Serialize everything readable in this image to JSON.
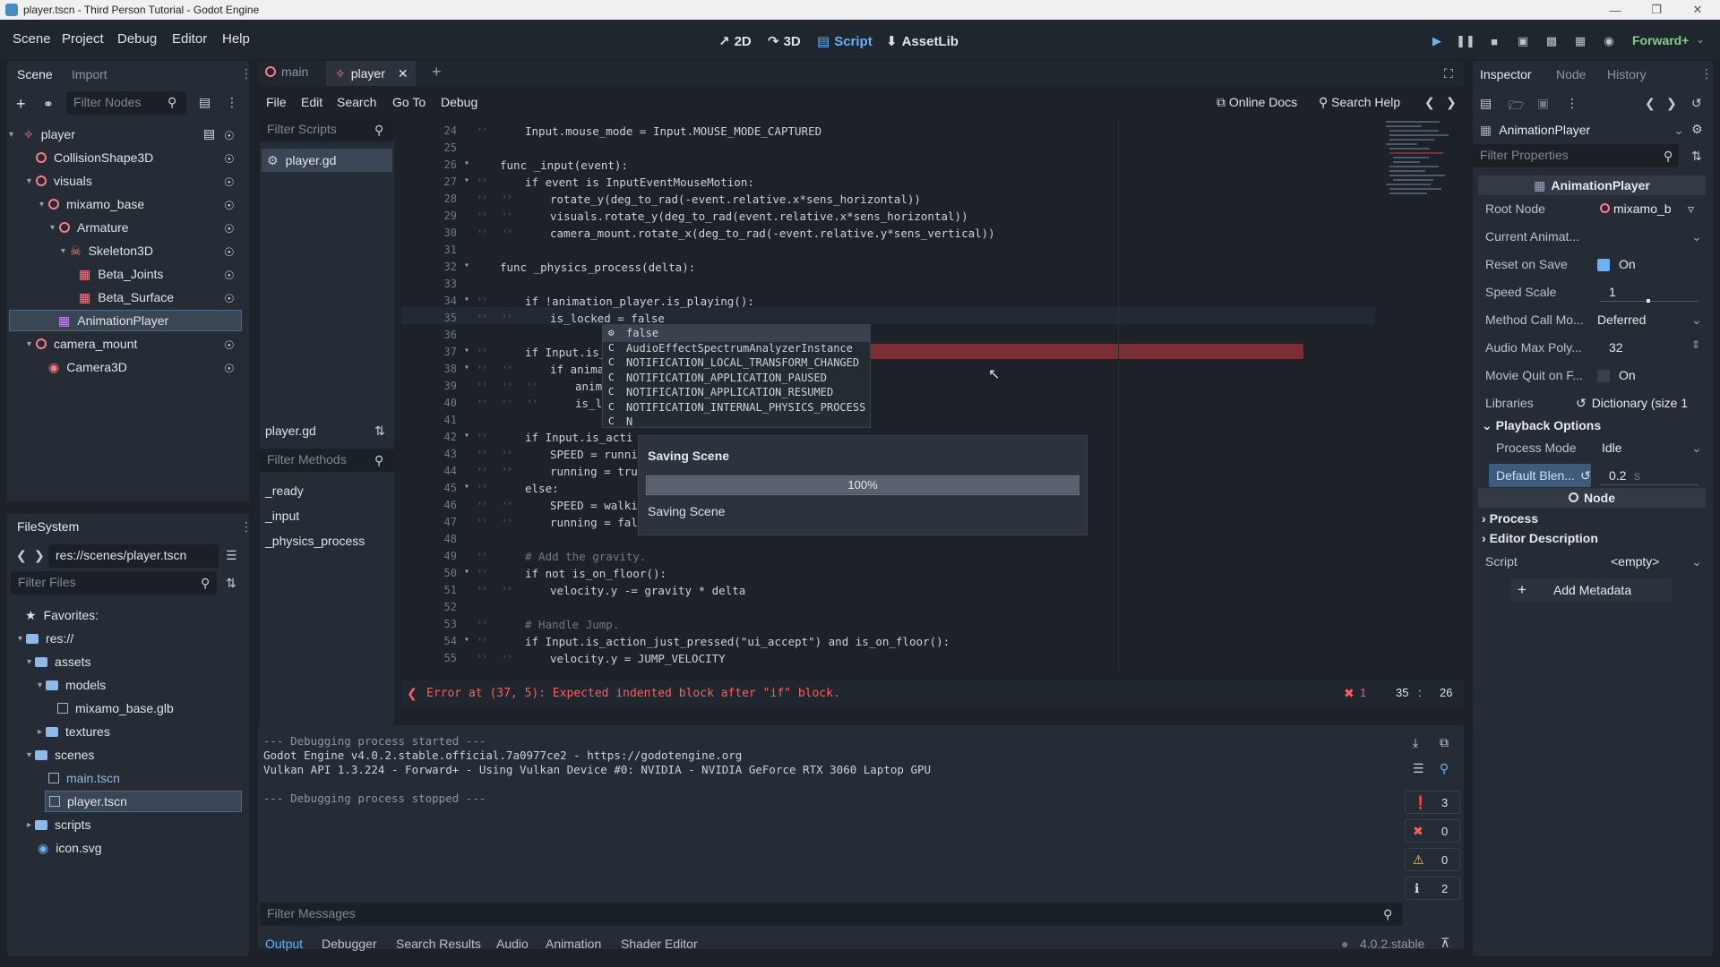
{
  "window": {
    "title": "player.tscn - Third Person Tutorial - Godot Engine"
  },
  "menu": [
    "Scene",
    "Project",
    "Debug",
    "Editor",
    "Help"
  ],
  "workspaces": [
    {
      "label": "2D",
      "icon": "2d-icon"
    },
    {
      "label": "3D",
      "icon": "3d-icon"
    },
    {
      "label": "Script",
      "icon": "script-icon"
    },
    {
      "label": "AssetLib",
      "icon": "assetlib-icon"
    }
  ],
  "renderer": "Forward+",
  "scene_dock": {
    "tabs": [
      "Scene",
      "Import"
    ],
    "filter_placeholder": "Filter Nodes",
    "nodes": [
      {
        "label": "player"
      },
      {
        "label": "CollisionShape3D"
      },
      {
        "label": "visuals"
      },
      {
        "label": "mixamo_base"
      },
      {
        "label": "Armature"
      },
      {
        "label": "Skeleton3D"
      },
      {
        "label": "Beta_Joints"
      },
      {
        "label": "Beta_Surface"
      },
      {
        "label": "AnimationPlayer"
      },
      {
        "label": "camera_mount"
      },
      {
        "label": "Camera3D"
      }
    ]
  },
  "filesystem": {
    "title": "FileSystem",
    "path": "res://scenes/player.tscn",
    "filter_placeholder": "Filter Files",
    "items": [
      {
        "label": "Favorites:"
      },
      {
        "label": "res://"
      },
      {
        "label": "assets"
      },
      {
        "label": "models"
      },
      {
        "label": "mixamo_base.glb"
      },
      {
        "label": "textures"
      },
      {
        "label": "scenes"
      },
      {
        "label": "main.tscn"
      },
      {
        "label": "player.tscn"
      },
      {
        "label": "scripts"
      },
      {
        "label": "icon.svg"
      }
    ]
  },
  "editor_tabs": [
    {
      "label": "main"
    },
    {
      "label": "player"
    }
  ],
  "script_menu": [
    "File",
    "Edit",
    "Search",
    "Go To",
    "Debug"
  ],
  "script_toolbar": {
    "online_docs": "Online Docs",
    "search_help": "Search Help"
  },
  "scripts_panel": {
    "filter_placeholder": "Filter Scripts",
    "scripts": [
      "player.gd"
    ],
    "current": "player.gd",
    "methods_placeholder": "Filter Methods",
    "methods": [
      "_ready",
      "_input",
      "_physics_process"
    ]
  },
  "code_lines": [
    {
      "n": "24",
      "t": "Input.mouse_mode = Input.MOUSE_MODE_CAPTURED"
    },
    {
      "n": "25",
      "t": ""
    },
    {
      "n": "26",
      "t": "func _input(event):"
    },
    {
      "n": "27",
      "t": "if event is InputEventMouseMotion:"
    },
    {
      "n": "28",
      "t": "rotate_y(deg_to_rad(-event.relative.x*sens_horizontal))"
    },
    {
      "n": "29",
      "t": "visuals.rotate_y(deg_to_rad(event.relative.x*sens_horizontal))"
    },
    {
      "n": "30",
      "t": "camera_mount.rotate_x(deg_to_rad(-event.relative.y*sens_vertical))"
    },
    {
      "n": "31",
      "t": ""
    },
    {
      "n": "32",
      "t": "func _physics_process(delta):"
    },
    {
      "n": "33",
      "t": ""
    },
    {
      "n": "34",
      "t": "if !animation_player.is_playing():"
    },
    {
      "n": "35",
      "t": "is_locked = false"
    },
    {
      "n": "36",
      "t": ""
    },
    {
      "n": "37",
      "t": "if Input.is_acti"
    },
    {
      "n": "38",
      "t": "if animation"
    },
    {
      "n": "39",
      "t": "animatio"
    },
    {
      "n": "40",
      "t": "is_locke"
    },
    {
      "n": "41",
      "t": ""
    },
    {
      "n": "42",
      "t": "if Input.is_acti"
    },
    {
      "n": "43",
      "t": "SPEED = running_s"
    },
    {
      "n": "44",
      "t": "running = true"
    },
    {
      "n": "45",
      "t": "else:"
    },
    {
      "n": "46",
      "t": "SPEED = walking_s"
    },
    {
      "n": "47",
      "t": "running = false"
    },
    {
      "n": "48",
      "t": ""
    },
    {
      "n": "49",
      "t": "# Add the gravity."
    },
    {
      "n": "50",
      "t": "if not is_on_floor():"
    },
    {
      "n": "51",
      "t": "velocity.y -= gravity * delta"
    },
    {
      "n": "52",
      "t": ""
    },
    {
      "n": "53",
      "t": "# Handle Jump."
    },
    {
      "n": "54",
      "t": "if Input.is_action_just_pressed(\"ui_accept\") and is_on_floor():"
    },
    {
      "n": "55",
      "t": "velocity.y = JUMP_VELOCITY"
    }
  ],
  "autocomplete": [
    "false",
    "AudioEffectSpectrumAnalyzerInstance",
    "NOTIFICATION_LOCAL_TRANSFORM_CHANGED",
    "NOTIFICATION_APPLICATION_PAUSED",
    "NOTIFICATION_APPLICATION_RESUMED",
    "NOTIFICATION_INTERNAL_PHYSICS_PROCESS",
    "N"
  ],
  "saving_dialog": {
    "title": "Saving Scene",
    "percent": "100%",
    "progress": 1.0,
    "status": "Saving Scene"
  },
  "status_bar": {
    "error": "Error at (37, 5): Expected indented block after \"if\" block.",
    "error_count": "1",
    "line": "35",
    "col": "26"
  },
  "output": {
    "lines": [
      "--- Debugging process started ---",
      "Godot Engine v4.0.2.stable.official.7a0977ce2 - https://godotengine.org",
      "Vulkan API 1.3.224 - Forward+ - Using Vulkan Device #0: NVIDIA - NVIDIA GeForce RTX 3060 Laptop GPU",
      "",
      "--- Debugging process stopped ---"
    ],
    "filter_placeholder": "Filter Messages",
    "counts": {
      "messages": "3",
      "errors": "0",
      "warnings": "0",
      "info": "2"
    },
    "tabs": [
      "Output",
      "Debugger",
      "Search Results",
      "Audio",
      "Animation",
      "Shader Editor"
    ],
    "version": "4.0.2.stable"
  },
  "inspector": {
    "tabs": [
      "Inspector",
      "Node",
      "History"
    ],
    "object": "AnimationPlayer",
    "filter_placeholder": "Filter Properties",
    "header": "AnimationPlayer",
    "props": {
      "root_node": {
        "label": "Root Node",
        "value": "mixamo_b"
      },
      "current_anim": {
        "label": "Current Animat...",
        "value": ""
      },
      "reset_on_save": {
        "label": "Reset on Save",
        "value": "On"
      },
      "speed_scale": {
        "label": "Speed Scale",
        "value": "1"
      },
      "method_call": {
        "label": "Method Call Mo...",
        "value": "Deferred"
      },
      "audio_max": {
        "label": "Audio Max Poly...",
        "value": "32"
      },
      "movie_quit": {
        "label": "Movie Quit on F...",
        "value": "On"
      },
      "libraries": {
        "label": "Libraries",
        "value": "Dictionary (size 1"
      }
    },
    "playback": {
      "title": "Playback Options",
      "process_mode": {
        "label": "Process Mode",
        "value": "Idle"
      },
      "default_blend": {
        "label": "Default Blen...",
        "value": "0.2",
        "unit": "s"
      }
    },
    "node_header": "Node",
    "process": "Process",
    "editor_description": "Editor Description",
    "script": {
      "label": "Script",
      "value": "<empty>"
    },
    "add_metadata": "Add Metadata"
  },
  "colors": {
    "accent": "#6bb1f7",
    "error": "#ff5d5d",
    "node": "#ff7a88",
    "bg": "#1d2229",
    "panel": "#262c35"
  }
}
